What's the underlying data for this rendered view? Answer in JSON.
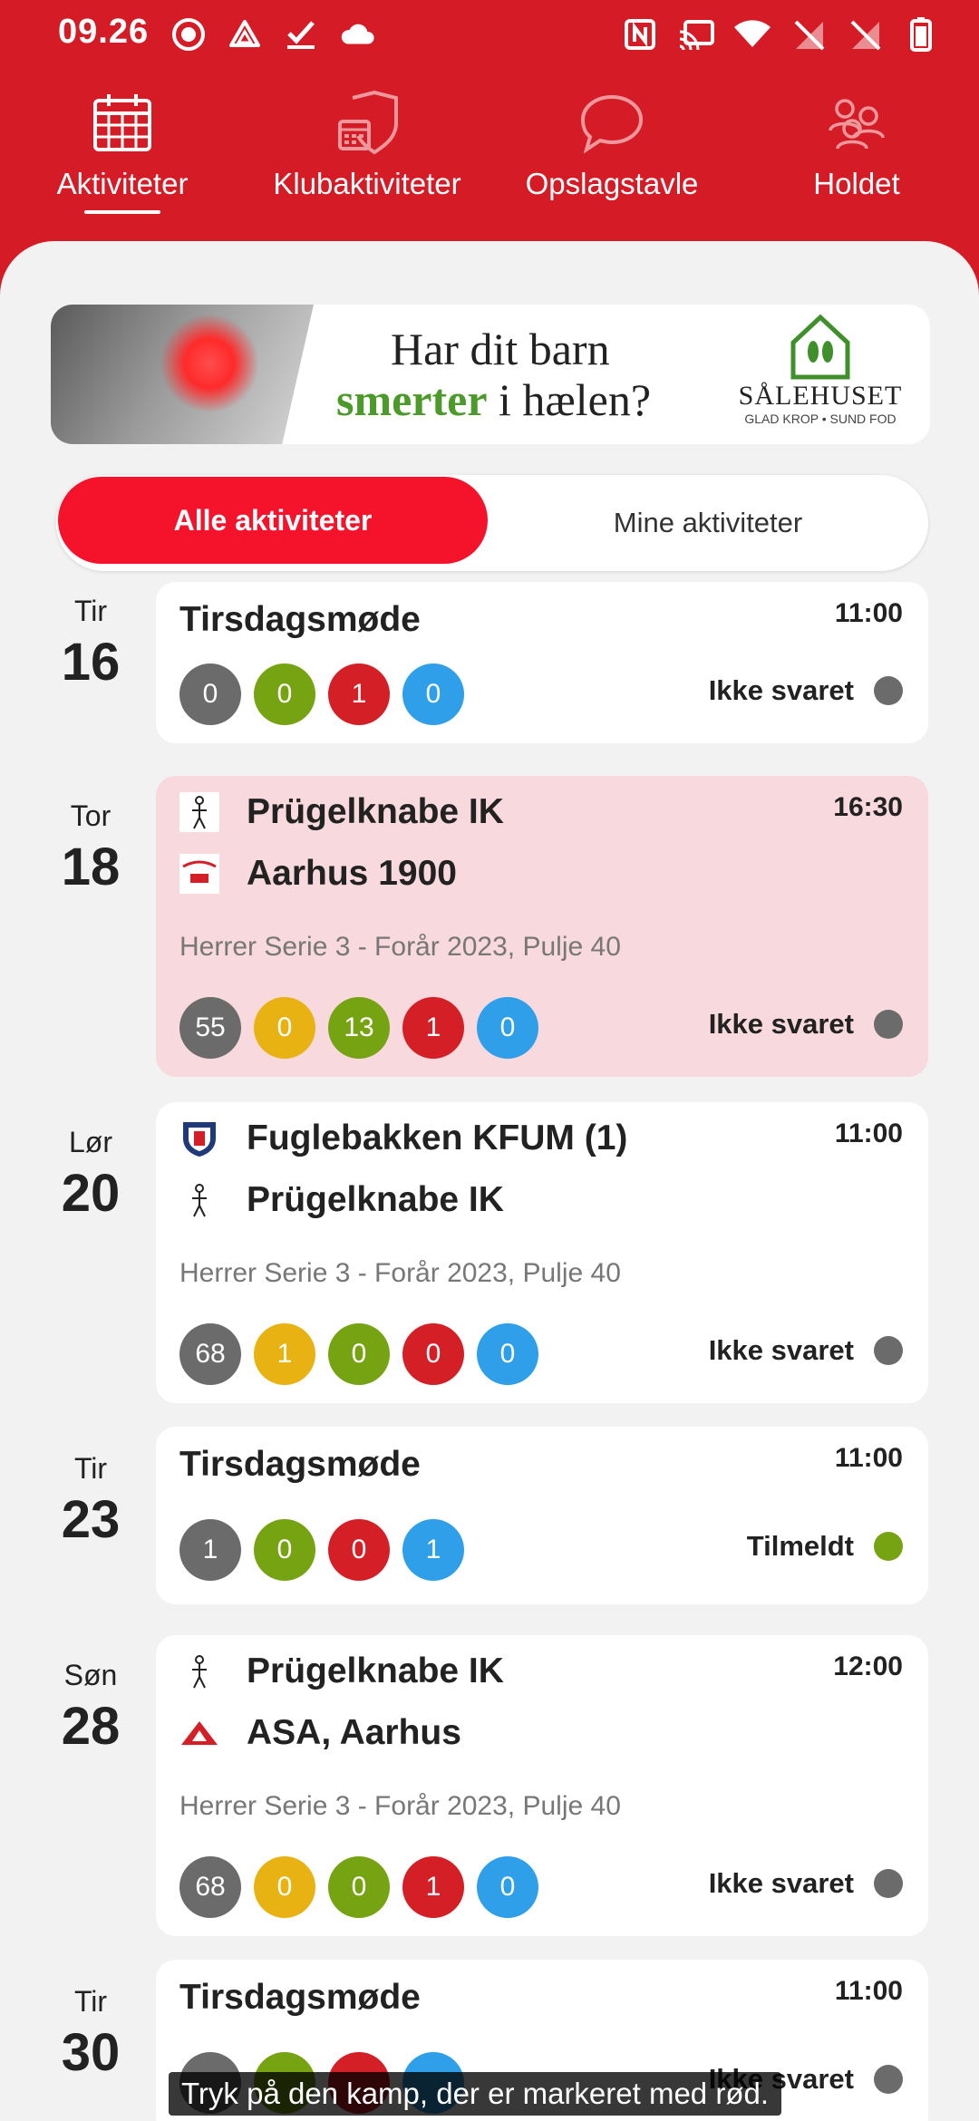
{
  "status_bar": {
    "time": "09.26",
    "left_icons": [
      "record-icon",
      "drive-icon",
      "check-icon",
      "cloud-icon"
    ],
    "right_icons": [
      "nfc-icon",
      "cast-icon",
      "wifi-icon",
      "no-sim-icon",
      "no-sim-icon",
      "battery-icon"
    ]
  },
  "tabs": [
    {
      "label": "Aktiviteter",
      "icon": "calendar-icon",
      "active": true
    },
    {
      "label": "Klubaktiviteter",
      "icon": "club-calendar-icon",
      "active": false
    },
    {
      "label": "Opslagstavle",
      "icon": "chat-bubble-icon",
      "active": false
    },
    {
      "label": "Holdet",
      "icon": "team-icon",
      "active": false
    }
  ],
  "banner": {
    "line1": "Har dit barn",
    "line2_highlight": "smerter",
    "line2_rest": " i hælen?",
    "brand": "SÅLEHUSET",
    "tagline": "GLAD KROP • SUND FOD"
  },
  "segment": {
    "active": "Alle aktiviteter",
    "inactive": "Mine aktiviteter"
  },
  "events": [
    {
      "day": "Tir",
      "date": "16",
      "title": "Tirsdagsmøde",
      "time": "11:00",
      "counts": [
        {
          "v": "0",
          "c": "#6b6b6b"
        },
        {
          "v": "0",
          "c": "#76a312"
        },
        {
          "v": "1",
          "c": "#d51f26"
        },
        {
          "v": "0",
          "c": "#2e9fe8"
        }
      ],
      "status": "Ikke svaret",
      "status_color": "#6b6b6b"
    },
    {
      "day": "Tor",
      "date": "18",
      "home": "Prügelknabe IK",
      "away": "Aarhus 1900",
      "time": "16:30",
      "league": "Herrer Serie 3 -  Forår 2023, Pulje 40",
      "counts": [
        {
          "v": "55",
          "c": "#6b6b6b"
        },
        {
          "v": "0",
          "c": "#e8b213"
        },
        {
          "v": "13",
          "c": "#76a312"
        },
        {
          "v": "1",
          "c": "#d51f26"
        },
        {
          "v": "0",
          "c": "#2e9fe8"
        }
      ],
      "status": "Ikke svaret",
      "status_color": "#6b6b6b",
      "highlight": true
    },
    {
      "day": "Lør",
      "date": "20",
      "home": "Fuglebakken KFUM (1)",
      "away": "Prügelknabe IK",
      "time": "11:00",
      "league": "Herrer Serie 3 -  Forår 2023, Pulje 40",
      "counts": [
        {
          "v": "68",
          "c": "#6b6b6b"
        },
        {
          "v": "1",
          "c": "#e8b213"
        },
        {
          "v": "0",
          "c": "#76a312"
        },
        {
          "v": "0",
          "c": "#d51f26"
        },
        {
          "v": "0",
          "c": "#2e9fe8"
        }
      ],
      "status": "Ikke svaret",
      "status_color": "#6b6b6b"
    },
    {
      "day": "Tir",
      "date": "23",
      "title": "Tirsdagsmøde",
      "time": "11:00",
      "counts": [
        {
          "v": "1",
          "c": "#6b6b6b"
        },
        {
          "v": "0",
          "c": "#76a312"
        },
        {
          "v": "0",
          "c": "#d51f26"
        },
        {
          "v": "1",
          "c": "#2e9fe8"
        }
      ],
      "status": "Tilmeldt",
      "status_color": "#76a312"
    },
    {
      "day": "Søn",
      "date": "28",
      "home": "Prügelknabe IK",
      "away": "ASA, Aarhus",
      "time": "12:00",
      "league": "Herrer Serie 3 -  Forår 2023, Pulje 40",
      "counts": [
        {
          "v": "68",
          "c": "#6b6b6b"
        },
        {
          "v": "0",
          "c": "#e8b213"
        },
        {
          "v": "0",
          "c": "#76a312"
        },
        {
          "v": "1",
          "c": "#d51f26"
        },
        {
          "v": "0",
          "c": "#2e9fe8"
        }
      ],
      "status": "Ikke svaret",
      "status_color": "#6b6b6b"
    },
    {
      "day": "Tir",
      "date": "30",
      "title": "Tirsdagsmøde",
      "time": "11:00",
      "counts": [
        {
          "v": "",
          "c": "#6b6b6b"
        },
        {
          "v": "",
          "c": "#76a312"
        },
        {
          "v": "",
          "c": "#d51f26"
        },
        {
          "v": "",
          "c": "#2e9fe8"
        }
      ],
      "status": "Ikke svaret",
      "status_color": "#6b6b6b"
    }
  ],
  "caption": "Tryk på den kamp, der er markeret med rød."
}
